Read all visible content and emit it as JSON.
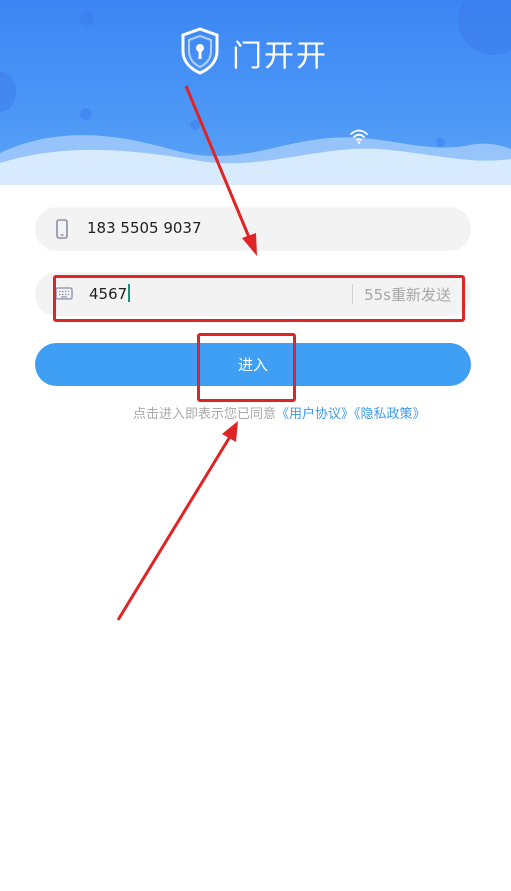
{
  "app": {
    "title": "门开开"
  },
  "login": {
    "phone_value": "183 5505 9037",
    "code_value": "4567",
    "resend_label": "55s重新发送",
    "submit_label": "进入"
  },
  "agreement": {
    "prefix": "点击进入即表示您已同意",
    "user_agreement": "《用户协议》",
    "privacy_policy": "《隐私政策》"
  },
  "colors": {
    "header_blue": "#3c86f4",
    "button_blue": "#3e9ff4",
    "link_blue": "#3c9bef",
    "annotation_red": "#e02323"
  },
  "icons": {
    "logo": "shield-keyhole-icon",
    "wifi": "wifi-icon",
    "phone": "phone-icon",
    "code": "keyboard-icon"
  }
}
